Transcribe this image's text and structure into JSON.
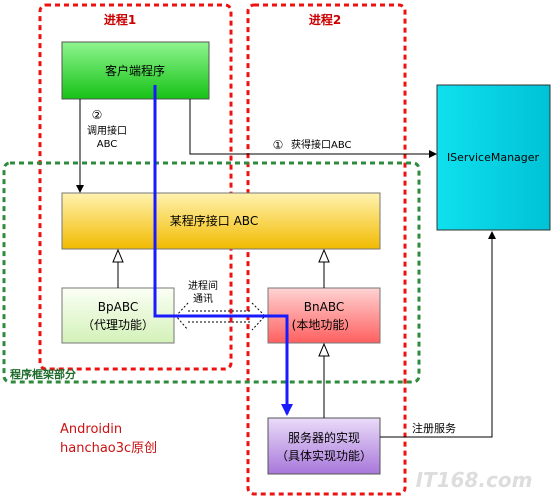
{
  "regions": {
    "process1": "进程1",
    "process2": "进程2",
    "framework": "程序框架部分"
  },
  "nodes": {
    "client": "客户端程序",
    "interface": "某程序接口 ABC",
    "bp_line1": "BpABC",
    "bp_line2": "（代理功能）",
    "bn_line1": "BnABC",
    "bn_line2": "(本地功能）",
    "server_line1": "服务器的实现",
    "server_line2": "（具体实现功能）",
    "service_manager": "IServiceManager"
  },
  "edges": {
    "step2_num": "②",
    "step2_line1": "调用接口",
    "step2_line2": "ABC",
    "step1_num": "①",
    "step1_label": "获得接口ABC",
    "ipc_line1": "进程间",
    "ipc_line2": "通讯",
    "register": "注册服务"
  },
  "credits": {
    "line1": "Androidin",
    "line2": "hanchao3c原创"
  },
  "watermark": "IT168.com",
  "colors": {
    "process_border": "#ee1111",
    "framework_border": "#2e8b3e",
    "client_fill": "#22dd22",
    "interface_fill": "#f5c400",
    "bp_fill": "#e4f7cf",
    "bn_fill": "#ff7a7a",
    "server_fill": "#b488e0",
    "service_manager_fill": "#00ccdd",
    "call_path": "#1a1aff",
    "credit_text": "#cc1111"
  }
}
